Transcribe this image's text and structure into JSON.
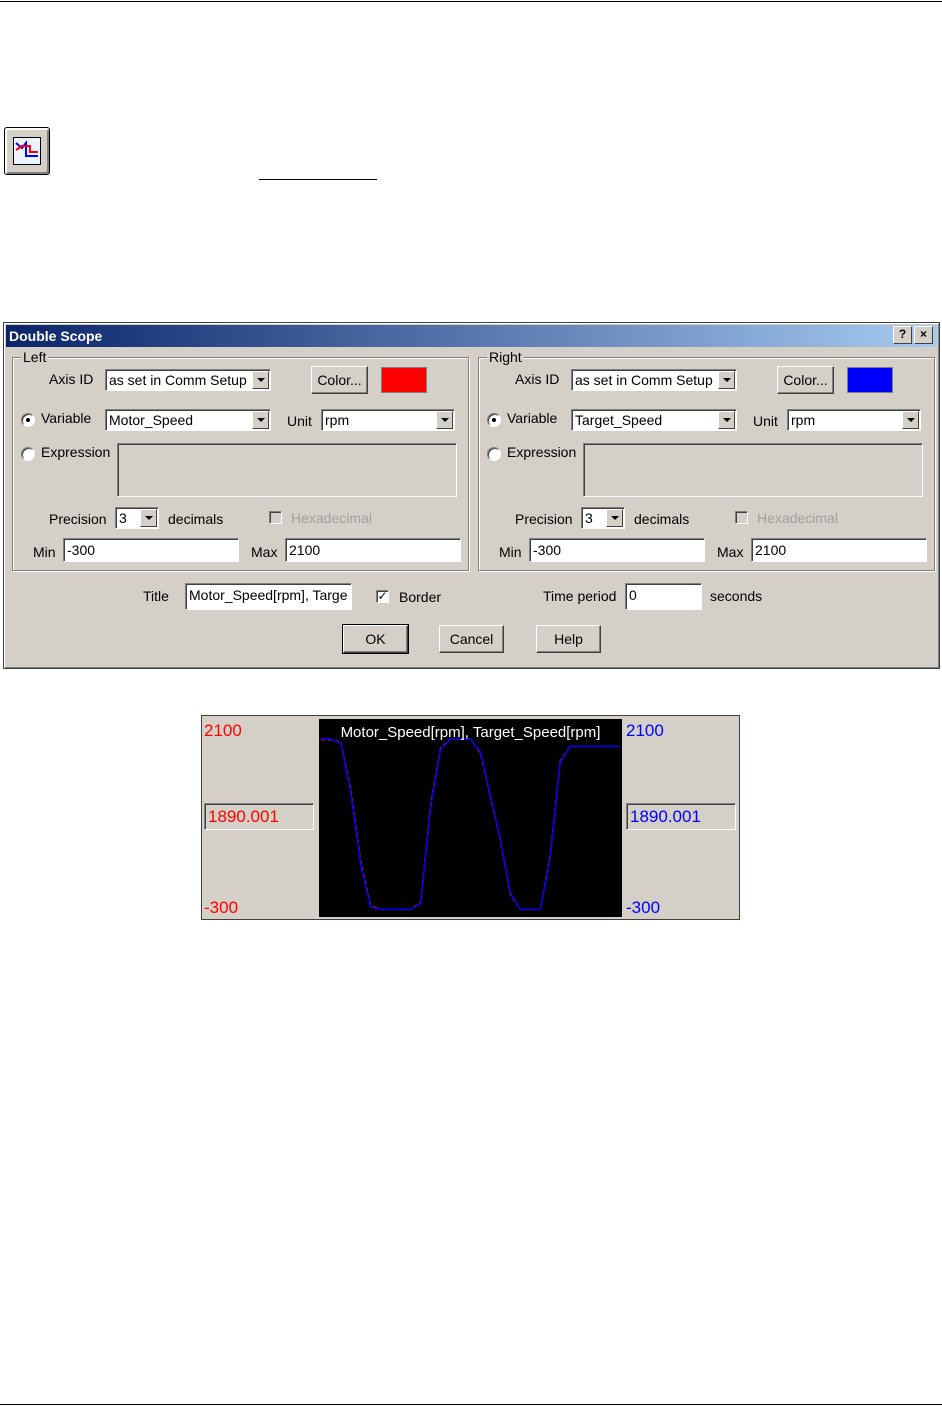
{
  "dialog": {
    "title": "Double Scope",
    "help_glyph": "?",
    "close_glyph": "×",
    "left": {
      "group_label": "Left",
      "axis_id_label": "Axis ID",
      "axis_id_value": "as set in Comm Setup",
      "color_button": "Color...",
      "color": "#ff0000",
      "variable_label": "Variable",
      "variable_value": "Motor_Speed",
      "unit_label": "Unit",
      "unit_value": "rpm",
      "expression_label": "Expression",
      "precision_label": "Precision",
      "precision_value": "3",
      "decimals_label": "decimals",
      "hex_label": "Hexadecimal",
      "min_label": "Min",
      "min_value": "-300",
      "max_label": "Max",
      "max_value": "2100"
    },
    "right": {
      "group_label": "Right",
      "axis_id_label": "Axis ID",
      "axis_id_value": "as set in Comm Setup",
      "color_button": "Color...",
      "color": "#0000ff",
      "variable_label": "Variable",
      "variable_value": "Target_Speed",
      "unit_label": "Unit",
      "unit_value": "rpm",
      "expression_label": "Expression",
      "precision_label": "Precision",
      "precision_value": "3",
      "decimals_label": "decimals",
      "hex_label": "Hexadecimal",
      "min_label": "Min",
      "min_value": "-300",
      "max_label": "Max",
      "max_value": "2100"
    },
    "title_label": "Title",
    "title_value": "Motor_Speed[rpm], Targe",
    "border_label": "Border",
    "border_check": "✓",
    "time_period_label": "Time period",
    "time_period_value": "0",
    "seconds_label": "seconds",
    "ok": "OK",
    "cancel": "Cancel",
    "help": "Help"
  },
  "scope": {
    "title": "Motor_Speed[rpm], Target_Speed[rpm]",
    "left_max": "2100",
    "left_min": "-300",
    "left_current": "1890.001",
    "right_max": "2100",
    "right_min": "-300",
    "right_current": "1890.001",
    "left_color": "#ff0000",
    "right_color": "#0000ff",
    "plot_bg": "#000000"
  },
  "chart_data": {
    "type": "line",
    "title": "Motor_Speed[rpm], Target_Speed[rpm]",
    "ylim": [
      -300,
      2100
    ],
    "x": [
      0,
      1,
      2,
      3,
      4,
      5,
      6,
      7,
      8,
      9,
      10,
      11,
      12,
      13,
      14,
      15,
      16,
      17,
      18,
      19,
      20,
      21,
      22,
      23,
      24,
      25,
      26,
      27,
      28,
      29,
      30
    ],
    "series": [
      {
        "name": "Motor_Speed[rpm]",
        "color": "#ff0000",
        "values": [
          2090,
          2090,
          2060,
          1400,
          400,
          -200,
          -250,
          -250,
          -250,
          -250,
          -150,
          1200,
          1980,
          2100,
          2100,
          2100,
          1900,
          1300,
          700,
          -50,
          -250,
          -250,
          -250,
          500,
          1800,
          2000,
          2000,
          2000,
          2000,
          2000,
          2000
        ]
      },
      {
        "name": "Target_Speed[rpm]",
        "color": "#0000ff",
        "values": [
          2100,
          2100,
          2040,
          1350,
          350,
          -220,
          -250,
          -250,
          -250,
          -250,
          -170,
          1150,
          1960,
          2100,
          2100,
          2100,
          1920,
          1320,
          720,
          -30,
          -250,
          -250,
          -250,
          450,
          1780,
          2000,
          2000,
          2000,
          2000,
          2000,
          2000
        ]
      }
    ]
  }
}
